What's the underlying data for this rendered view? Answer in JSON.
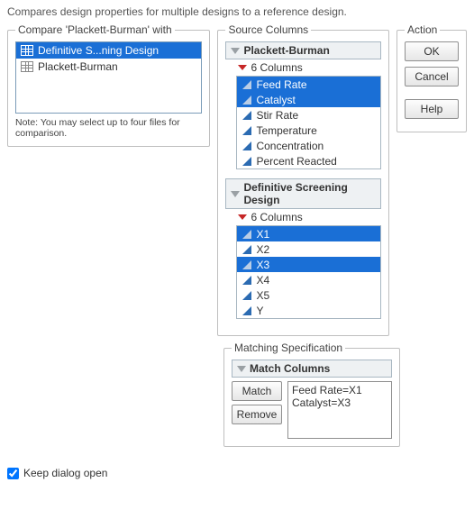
{
  "subtitle": "Compares design properties for multiple designs to a reference design.",
  "compare": {
    "legend": "Compare 'Plackett-Burman' with",
    "items": [
      {
        "label": "Definitive S...ning Design",
        "selected": true
      },
      {
        "label": "Plackett-Burman",
        "selected": false
      }
    ],
    "note": "Note: You may select up to four files for comparison."
  },
  "source": {
    "legend": "Source Columns",
    "groups": [
      {
        "title": "Plackett-Burman",
        "count_label": "6 Columns",
        "columns": [
          {
            "name": "Feed Rate",
            "selected": true
          },
          {
            "name": "Catalyst",
            "selected": true
          },
          {
            "name": "Stir Rate",
            "selected": false
          },
          {
            "name": "Temperature",
            "selected": false
          },
          {
            "name": "Concentration",
            "selected": false
          },
          {
            "name": "Percent Reacted",
            "selected": false
          }
        ]
      },
      {
        "title": "Definitive Screening Design",
        "count_label": "6 Columns",
        "columns": [
          {
            "name": "X1",
            "selected": true
          },
          {
            "name": "X2",
            "selected": false
          },
          {
            "name": "X3",
            "selected": true
          },
          {
            "name": "X4",
            "selected": false
          },
          {
            "name": "X5",
            "selected": false
          },
          {
            "name": "Y",
            "selected": false
          }
        ]
      }
    ]
  },
  "action": {
    "legend": "Action",
    "ok": "OK",
    "cancel": "Cancel",
    "help": "Help"
  },
  "matching": {
    "legend": "Matching Specification",
    "header": "Match Columns",
    "match_btn": "Match",
    "remove_btn": "Remove",
    "entries": [
      "Feed Rate=X1",
      "Catalyst=X3"
    ]
  },
  "keep_open": "Keep dialog open"
}
